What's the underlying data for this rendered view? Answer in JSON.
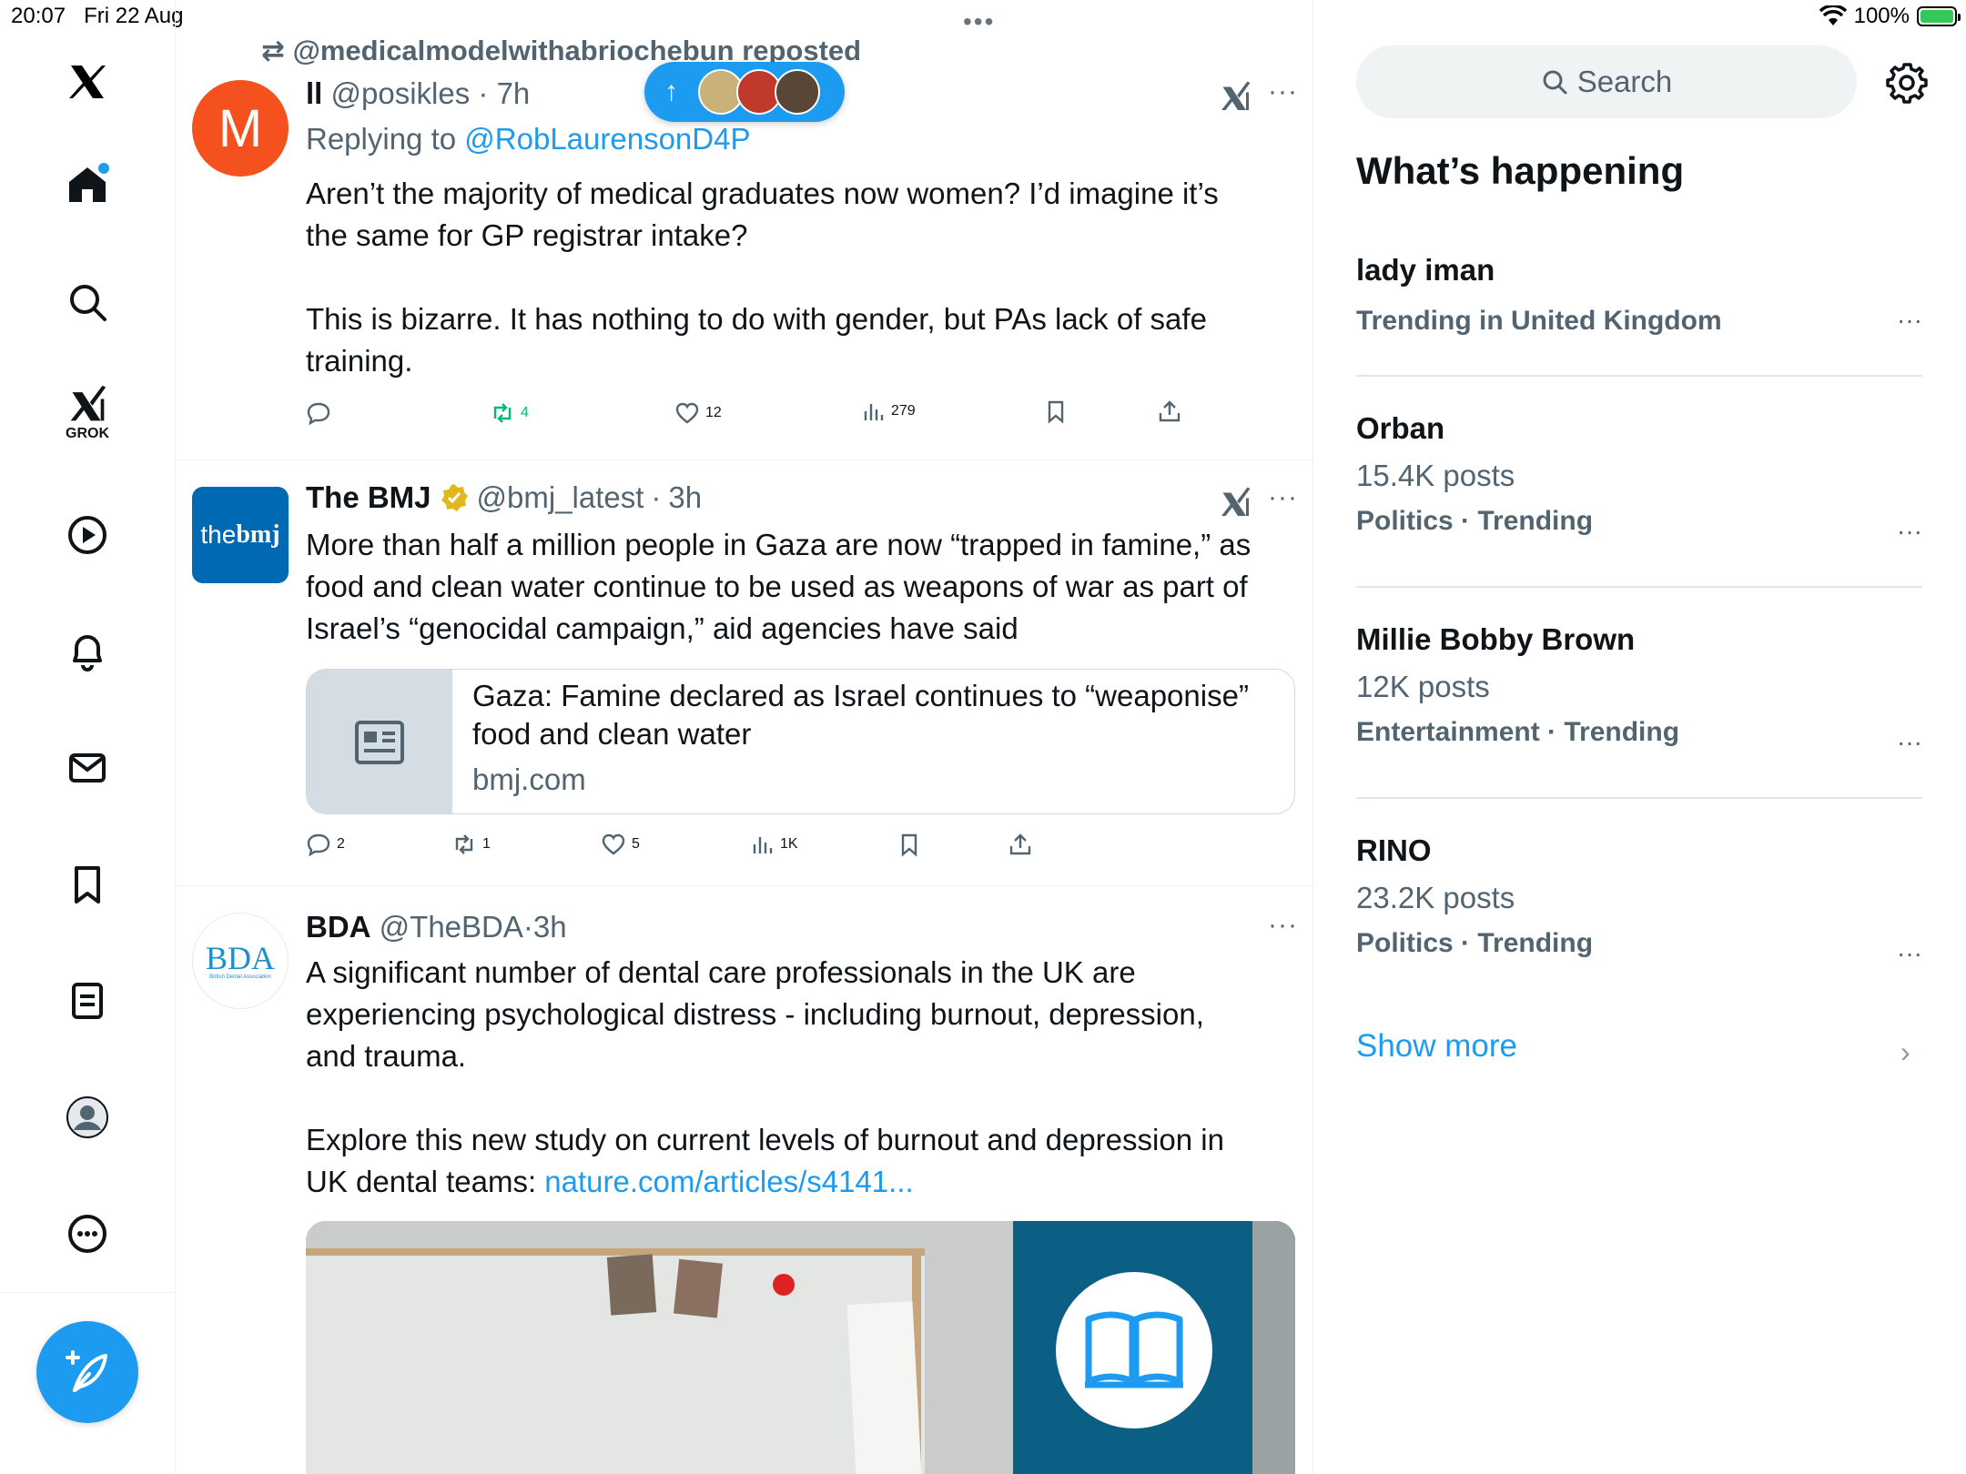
{
  "status_bar": {
    "time": "20:07",
    "date": "Fri 22 Aug",
    "battery": "100%"
  },
  "nav": {
    "items": [
      "x-logo-icon",
      "home-icon",
      "explore-icon",
      "grok-icon",
      "video-icon",
      "notifications-icon",
      "messages-icon",
      "bookmarks-icon",
      "lists-icon",
      "profile-icon",
      "more-icon"
    ],
    "grok_label": "GROK",
    "accent": "#1d9bf0"
  },
  "new_posts_pill": {
    "arrow": "↑"
  },
  "tweets": [
    {
      "repost_label": "@medicalmodelwithabriochebun reposted",
      "avatar_letter": "M",
      "avatar_color": "#f4511e",
      "display_name": "ll",
      "handle": "@posikles",
      "time": "7h",
      "replying_prefix": "Replying to",
      "replying_to": "@RobLaurensonD4P",
      "text": "Aren’t the majority of medical graduates now women? I’d imagine it’s\nthe same for GP registrar intake?\n\nThis is bizarre. It has nothing to do with gender, but PAs lack of safe\ntraining.",
      "replies": "",
      "reposts": "4",
      "likes": "12",
      "views": "279"
    },
    {
      "avatar_text_a": "the",
      "avatar_text_b": "bmj",
      "avatar_color": "#0069b4",
      "display_name": "The BMJ",
      "handle": "@bmj_latest",
      "time": "3h",
      "text": "More than half a million people in Gaza are now “trapped in famine,” as\nfood and clean water continue to be used as weapons of war as part of\nIsrael’s “genocidal campaign,” aid agencies have said",
      "card_title": "Gaza: Famine declared as Israel continues to “weaponise” food and clean water",
      "card_domain": "bmj.com",
      "replies": "2",
      "reposts": "1",
      "likes": "5",
      "views": "1K"
    },
    {
      "avatar_text": "BDA",
      "avatar_subtext": "British Dental Association",
      "display_name": "BDA",
      "handle": "@TheBDA",
      "time": "3h",
      "text": "A significant number of dental care professionals in the UK are\nexperiencing psychological distress - including burnout, depression,\nand trauma.\n\nExplore this new study on current levels of burnout and depression in\nUK dental teams: ",
      "link": "nature.com/articles/s4141..."
    }
  ],
  "sidebar": {
    "search_placeholder": "Search",
    "section_title": "What’s happening",
    "trends": [
      {
        "name": "lady iman",
        "posts": "",
        "context": "Trending in United Kingdom"
      },
      {
        "name": "Orban",
        "posts": "15.4K posts",
        "context": "Politics · Trending"
      },
      {
        "name": "Millie Bobby Brown",
        "posts": "12K posts",
        "context": "Entertainment · Trending"
      },
      {
        "name": "RINO",
        "posts": "23.2K posts",
        "context": "Politics · Trending"
      }
    ],
    "show_more": "Show more"
  }
}
